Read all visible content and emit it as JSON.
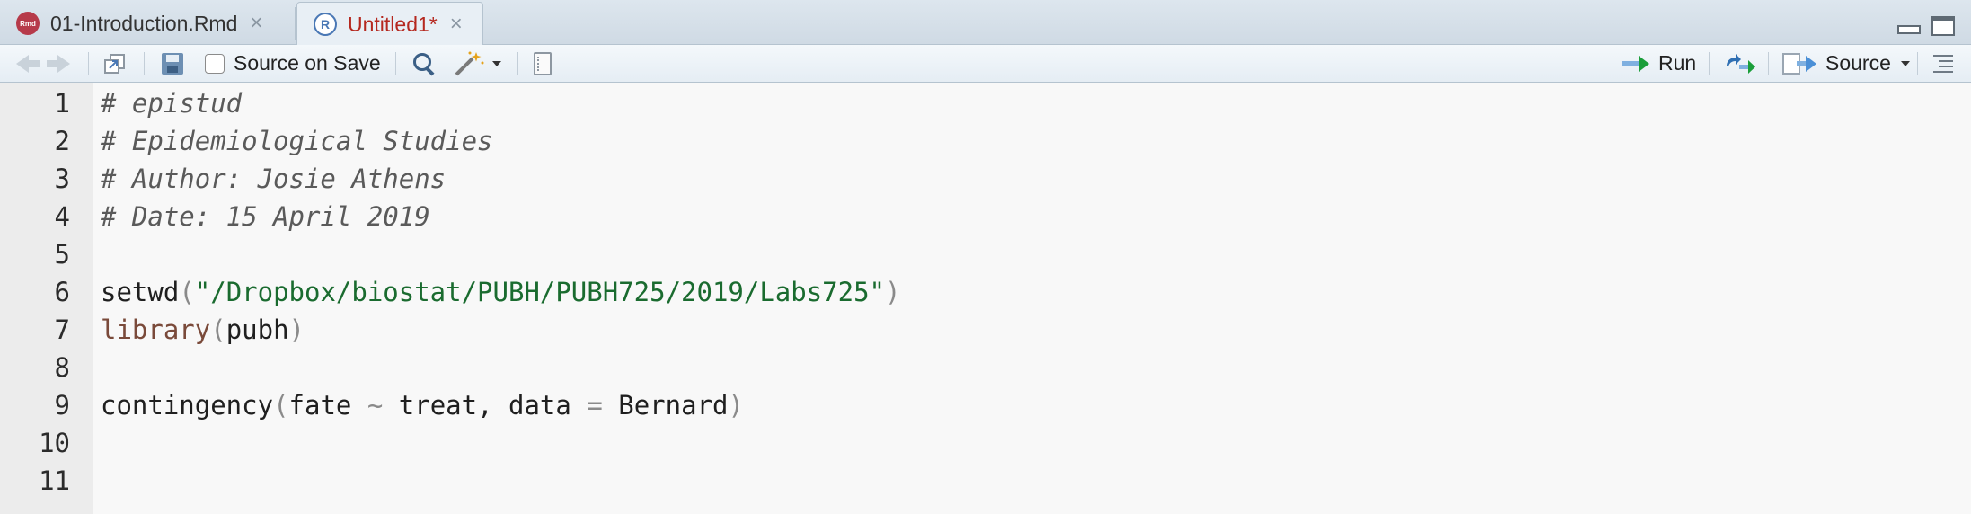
{
  "tabs": [
    {
      "label": "01-Introduction.Rmd",
      "icon": "rmd-file-icon",
      "icon_text": "Rmd",
      "active": false
    },
    {
      "label": "Untitled1*",
      "icon": "r-file-icon",
      "icon_text": "R",
      "active": true
    }
  ],
  "toolbar": {
    "source_on_save": "Source on Save",
    "run": "Run",
    "source": "Source"
  },
  "editor": {
    "line_numbers": [
      "1",
      "2",
      "3",
      "4",
      "5",
      "6",
      "7",
      "8",
      "9",
      "10",
      "11"
    ],
    "lines": [
      "# epistud",
      "# Epidemiological Studies",
      "# Author: Josie Athens",
      "# Date: 15 April 2019",
      "",
      "setwd(\"/Dropbox/biostat/PUBH/PUBH725/2019/Labs725\")",
      "library(pubh)",
      "",
      "contingency(fate ~ treat, data = Bernard)",
      "",
      ""
    ],
    "tokens": {
      "setwd_fn": "setwd",
      "setwd_arg": "\"/Dropbox/biostat/PUBH/PUBH725/2019/Labs725\"",
      "library_fn": "library",
      "library_arg": "pubh",
      "cont_fn": "contingency",
      "cont_a": "fate",
      "cont_tilde": "~",
      "cont_b": "treat,",
      "cont_c": "data",
      "cont_eq": "=",
      "cont_d": "Bernard"
    }
  },
  "colors": {
    "active_tab_text": "#b5281f",
    "comment": "#5a5a5a",
    "string": "#1a6b2f",
    "run_arrow": "#1a9e3a"
  }
}
